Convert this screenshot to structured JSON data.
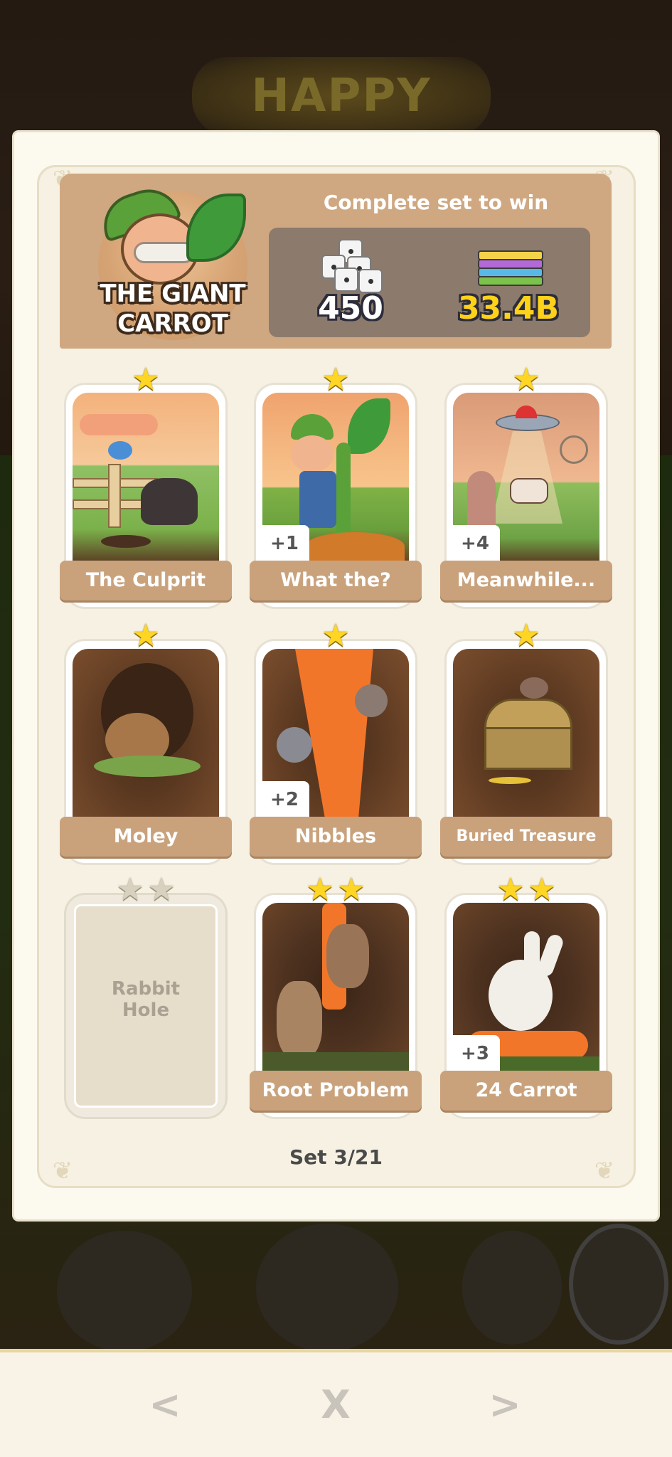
{
  "header": {
    "character_title_line1": "THE GIANT",
    "character_title_line2": "CARROT",
    "win_label": "Complete set to win",
    "reward_dice": "450",
    "reward_cash": "33.4B"
  },
  "background": {
    "logo_text": "HAPPY"
  },
  "cards": [
    {
      "label": "The Culprit",
      "stars": 1,
      "dupes": ""
    },
    {
      "label": "What the?",
      "stars": 1,
      "dupes": "+1"
    },
    {
      "label": "Meanwhile...",
      "stars": 1,
      "dupes": "+4"
    },
    {
      "label": "Moley",
      "stars": 1,
      "dupes": ""
    },
    {
      "label": "Nibbles",
      "stars": 1,
      "dupes": "+2"
    },
    {
      "label": "Buried Treasure",
      "stars": 1,
      "dupes": ""
    },
    {
      "label": "Rabbit Hole",
      "stars": 2,
      "locked": true
    },
    {
      "label": "Root Problem",
      "stars": 2,
      "dupes": ""
    },
    {
      "label": "24 Carrot",
      "stars": 2,
      "dupes": "+3"
    }
  ],
  "set_progress": "Set 3/21",
  "nav": {
    "prev": "<",
    "close": "X",
    "next": ">"
  },
  "colors": {
    "panel": "#fcf9ef",
    "header": "#cfa881",
    "label": "#c9a27c",
    "star": "#ffd624",
    "cash_text": "#ffd21a"
  }
}
